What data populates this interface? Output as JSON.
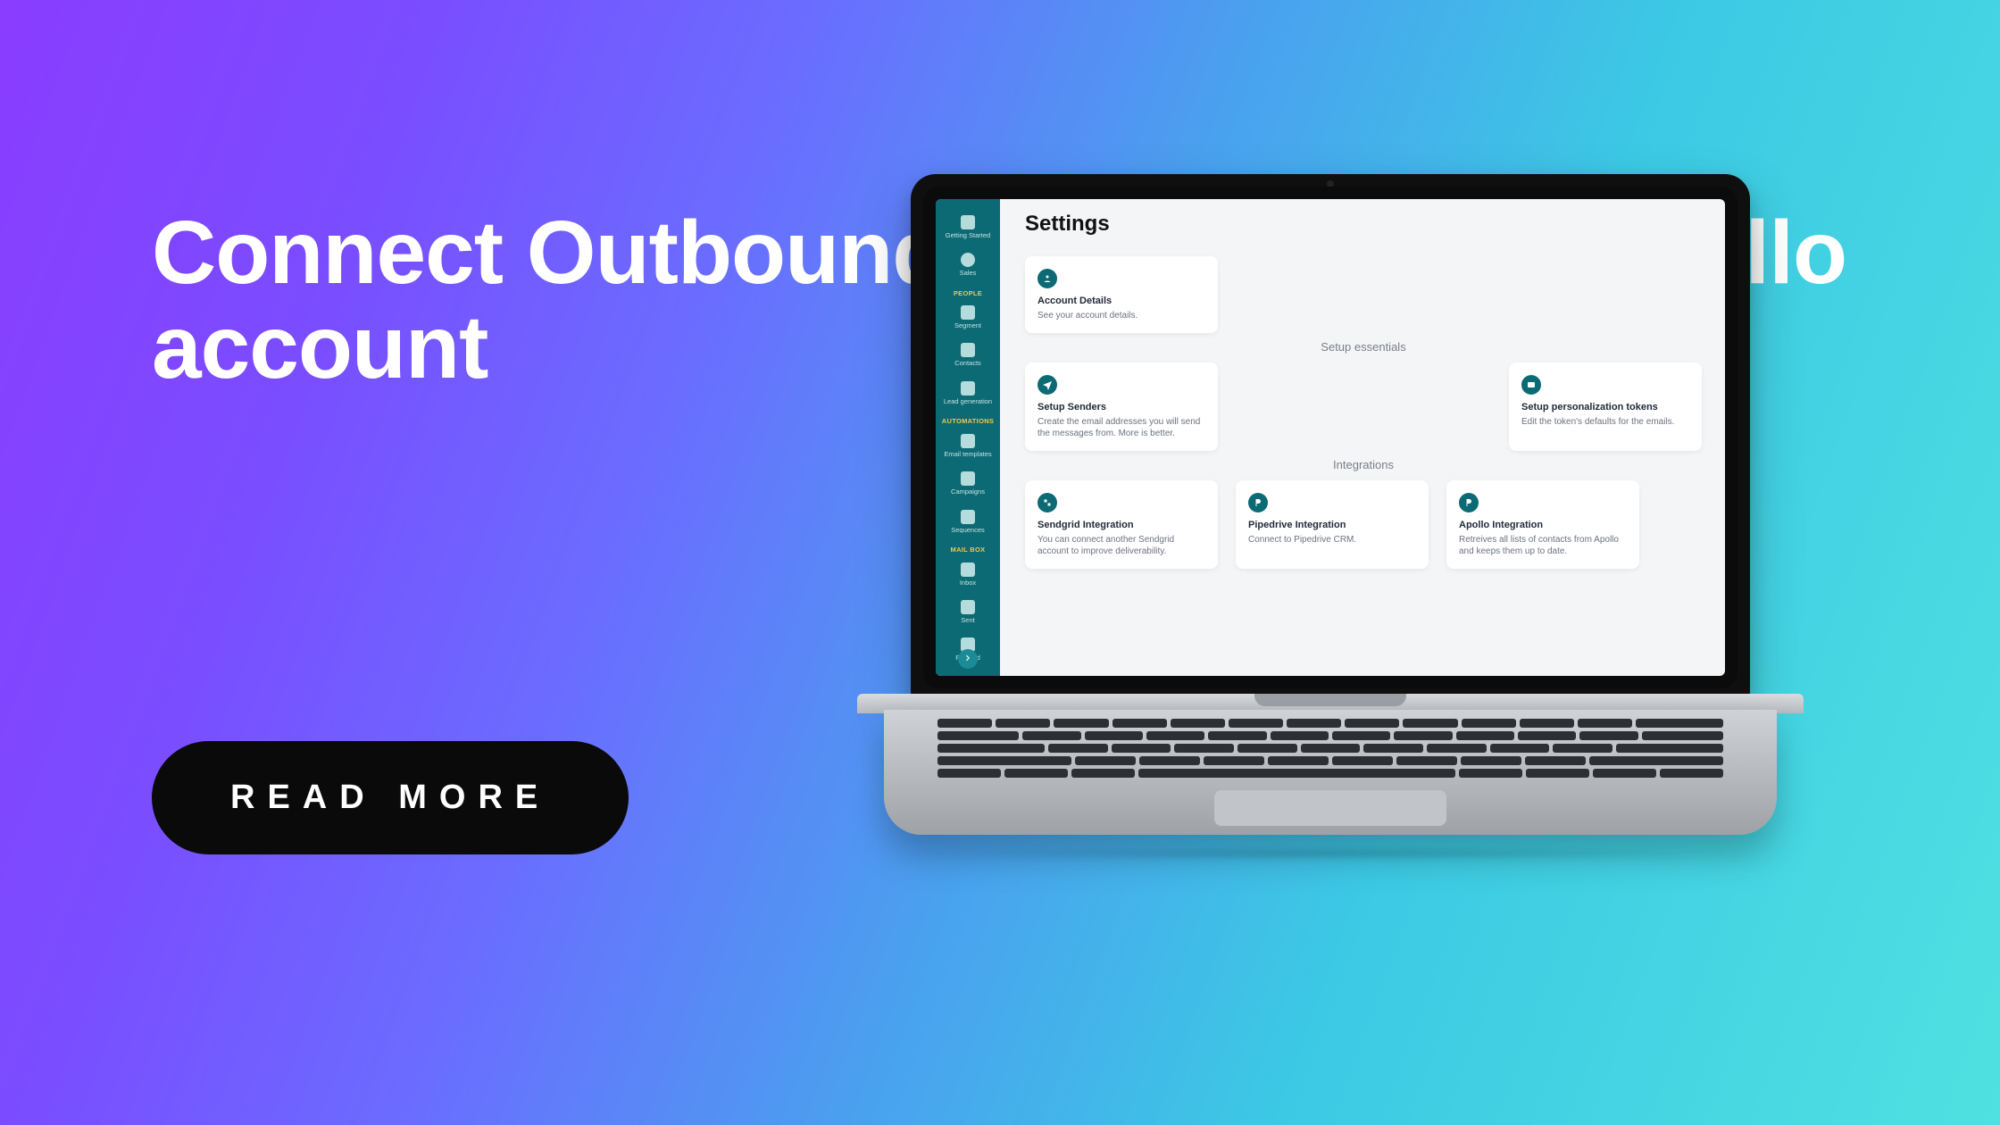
{
  "hero": {
    "title": "Connect Outbound Rocks to your Apollo account"
  },
  "cta": {
    "label": "READ MORE"
  },
  "app": {
    "page_title": "Settings",
    "sidebar": {
      "items_top": [
        {
          "label": "Getting Started"
        },
        {
          "label": "Sales"
        }
      ],
      "section_people": "PEOPLE",
      "items_people": [
        {
          "label": "Segment"
        },
        {
          "label": "Contacts"
        },
        {
          "label": "Lead generation"
        }
      ],
      "section_automations": "AUTOMATIONS",
      "items_automations": [
        {
          "label": "Email templates"
        },
        {
          "label": "Campaigns"
        },
        {
          "label": "Sequences"
        }
      ],
      "section_mailbox": "MAIL BOX",
      "items_mailbox": [
        {
          "label": "Inbox"
        },
        {
          "label": "Sent"
        },
        {
          "label": "Forward"
        }
      ]
    },
    "sections": {
      "account": {
        "title": "",
        "cards": [
          {
            "title": "Account Details",
            "desc": "See your account details."
          }
        ]
      },
      "setup": {
        "title": "Setup essentials",
        "cards": [
          {
            "title": "Setup Senders",
            "desc": "Create the email addresses you will send the messages from. More is better."
          },
          {
            "title": "Setup personalization tokens",
            "desc": "Edit the token's defaults for the emails."
          }
        ]
      },
      "integrations": {
        "title": "Integrations",
        "cards": [
          {
            "title": "Sendgrid Integration",
            "desc": "You can connect another Sendgrid account to improve deliverability."
          },
          {
            "title": "Pipedrive Integration",
            "desc": "Connect to Pipedrive CRM."
          },
          {
            "title": "Apollo Integration",
            "desc": "Retreives all lists of contacts from Apollo and keeps them up to date."
          }
        ]
      }
    }
  }
}
